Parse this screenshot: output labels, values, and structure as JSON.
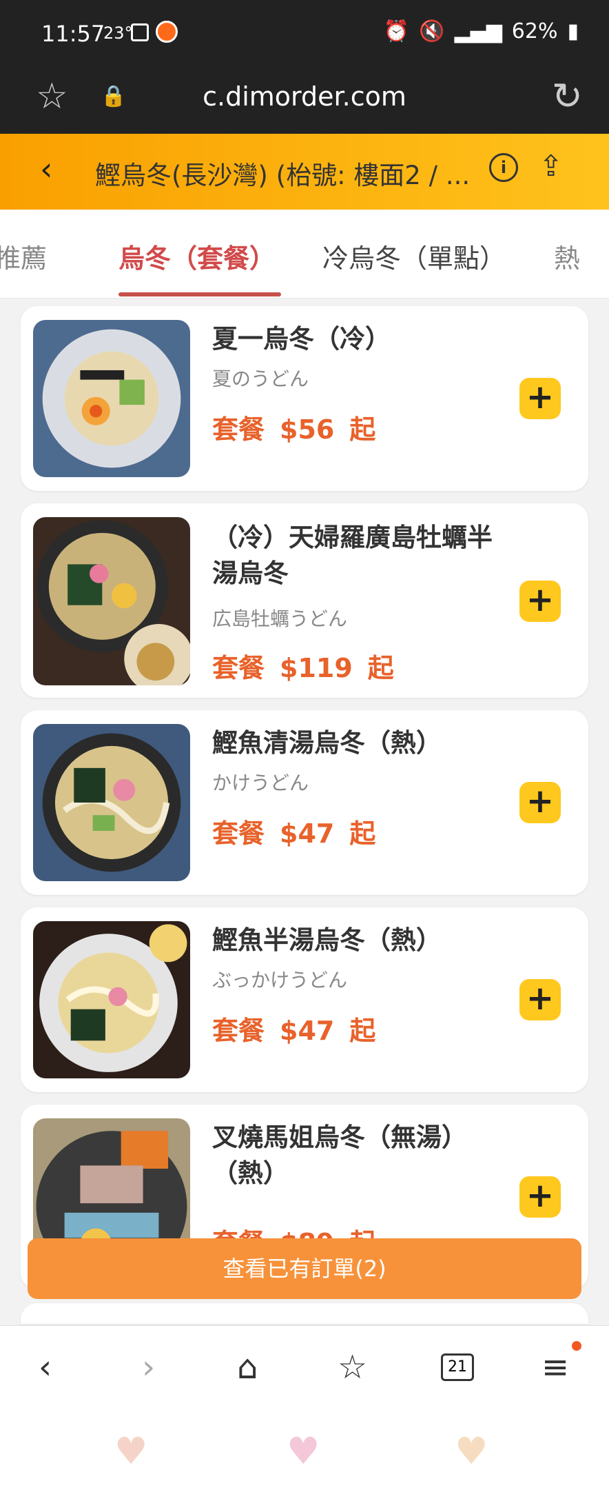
{
  "status_bar": {
    "time": "11:57",
    "temperature": "23°",
    "battery": "62%"
  },
  "browser": {
    "url": "c.dimorder.com"
  },
  "header": {
    "title": "鰹烏冬(長沙灣) (枱號: 樓面2 / ..."
  },
  "tabs": [
    {
      "label": "推薦"
    },
    {
      "label": "烏冬（套餐）"
    },
    {
      "label": "冷烏冬（單點）"
    },
    {
      "label": "熱"
    }
  ],
  "items": [
    {
      "name": "夏一烏冬（冷）",
      "subtitle": "夏のうどん",
      "price_prefix": "套餐",
      "price": "$56",
      "price_suffix": "起"
    },
    {
      "name": "（冷）天婦羅廣島牡蠣半湯烏冬",
      "subtitle": "広島牡蠣うどん",
      "price_prefix": "套餐",
      "price": "$119",
      "price_suffix": "起"
    },
    {
      "name": "鰹魚清湯烏冬（熱）",
      "subtitle": "かけうどん",
      "price_prefix": "套餐",
      "price": "$47",
      "price_suffix": "起"
    },
    {
      "name": "鰹魚半湯烏冬（熱）",
      "subtitle": "ぶっかけうどん",
      "price_prefix": "套餐",
      "price": "$47",
      "price_suffix": "起"
    },
    {
      "name": "叉燒馬姐烏冬（無湯）（熱）",
      "subtitle": "",
      "price_prefix": "套餐",
      "price": "$89",
      "price_suffix": "起"
    }
  ],
  "order_bar": {
    "label": "查看已有訂單(2)"
  },
  "bottom_nav": {
    "tab_count": "21"
  },
  "colors": {
    "accent": "#f7923a",
    "price": "#e8622b",
    "add_button": "#ffc81f",
    "active_tab": "#d24a4a"
  }
}
